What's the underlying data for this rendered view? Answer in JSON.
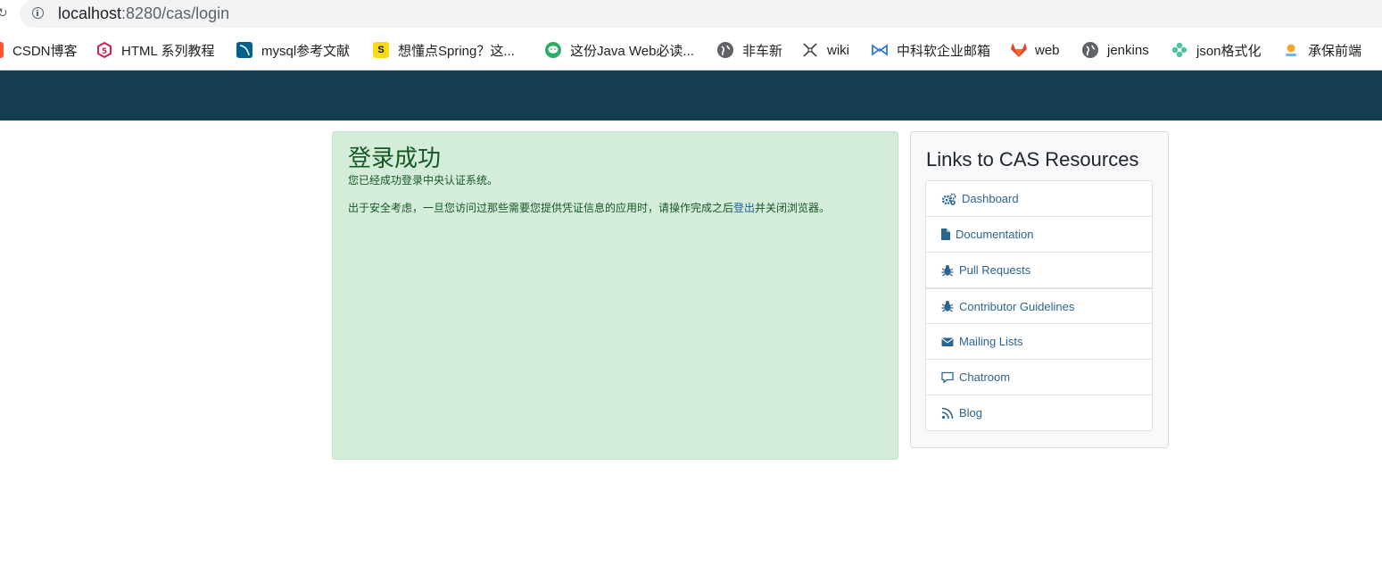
{
  "browser": {
    "url_host": "localhost",
    "url_path": ":8280/cas/login",
    "bookmarks": [
      {
        "label": "CSDN博客",
        "icon": "csdn-icon",
        "color": "#fc5531"
      },
      {
        "label": "HTML 系列教程",
        "icon": "html-tutorial-icon",
        "color": "#c7254e"
      },
      {
        "label": "mysql参考文献",
        "icon": "mysql-icon",
        "color": "#00618a"
      },
      {
        "label": "想懂点Spring？这...",
        "icon": "spring-icon",
        "color": "#f7d917"
      },
      {
        "label": "这份Java Web必读...",
        "icon": "wechat-icon",
        "color": "#2aae67"
      },
      {
        "label": "非车新",
        "icon": "globe-icon",
        "color": "#5f6368"
      },
      {
        "label": "wiki",
        "icon": "wiki-icon",
        "color": "#444444"
      },
      {
        "label": "中科软企业邮箱",
        "icon": "mail-logo-icon",
        "color": "#3a7bd5"
      },
      {
        "label": "web",
        "icon": "gitlab-icon",
        "color": "#e24329"
      },
      {
        "label": "jenkins",
        "icon": "globe-icon",
        "color": "#5f6368"
      },
      {
        "label": "json格式化",
        "icon": "json-icon",
        "color": "#4fc3a1"
      },
      {
        "label": "承保前端",
        "icon": "user-icon",
        "color": "#f5a623"
      }
    ]
  },
  "page": {
    "navbar_color": "#153e50",
    "success": {
      "title": "登录成功",
      "line1": "您已经成功登录中央认证系统。",
      "line2_before": "出于安全考虑，一旦您访问过那些需要您提供凭证信息的应用时，请操作完成之后",
      "line2_link": "登出",
      "line2_after": "并关闭浏览器。"
    },
    "resources": {
      "title": "Links to CAS Resources",
      "items": [
        {
          "label": "Dashboard",
          "icon": "cogs-icon"
        },
        {
          "label": "Documentation",
          "icon": "file-icon"
        },
        {
          "label": "Pull Requests",
          "icon": "bug-icon"
        },
        {
          "label": "Contributor Guidelines",
          "icon": "bug-icon"
        },
        {
          "label": "Mailing Lists",
          "icon": "envelope-icon"
        },
        {
          "label": "Chatroom",
          "icon": "comment-icon"
        },
        {
          "label": "Blog",
          "icon": "rss-icon"
        }
      ]
    }
  }
}
